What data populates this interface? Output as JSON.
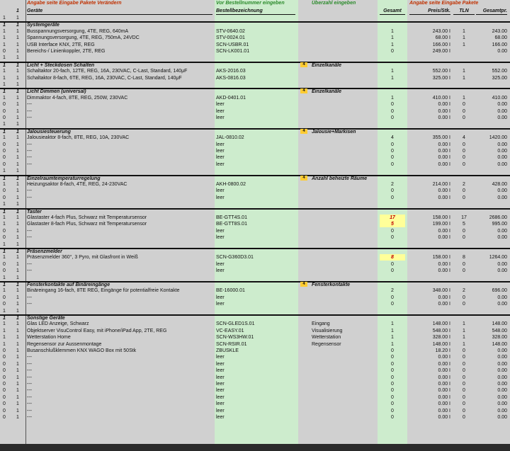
{
  "top_labels": {
    "left": "Angabe seite Eingabe Pakete Verändern",
    "middle": "Vor Bestellnummer eingeben",
    "middle2": "Überzahl eingeben",
    "right": "Angabe seite Eingabe Pakete"
  },
  "header": {
    "col0": "1",
    "geraete": "Geräte",
    "bestellbezeichnung": "Bestellbezeichnung",
    "gesamt": "Gesamt",
    "preis": "Preis/Stk.",
    "tln": "TLN",
    "gesamtpr": "Gesamtpr."
  },
  "rows": [
    {
      "type": "blank",
      "c0": "1",
      "c1": "1"
    },
    {
      "type": "section",
      "c0": "1",
      "c1": "1",
      "title": "Systemgeräte"
    },
    {
      "type": "item",
      "c0": "1",
      "c1": "1",
      "name": "Busspannungsversorgung, 4TE, REG, 640mA",
      "code": "STV-0640.02",
      "qty": "1",
      "price": "243.00 I",
      "tln": "1",
      "total": "243.00"
    },
    {
      "type": "item",
      "c0": "1",
      "c1": "1",
      "name": "Spannungsversorgung, 4TE, REG, 750mA, 24VDC",
      "code": "STV-0024.01",
      "qty": "1",
      "price": "68.00 I",
      "tln": "1",
      "total": "68.00"
    },
    {
      "type": "item",
      "c0": "1",
      "c1": "1",
      "name": "USB Interface KNX, 2TE, REG",
      "code": "SCN-USBR.01",
      "qty": "1",
      "price": "166.00 I",
      "tln": "1",
      "total": "166.00"
    },
    {
      "type": "item",
      "c0": "0",
      "c1": "1",
      "name": "Bereichs-/ Linienkoppler, 2TE, REG",
      "code": "SCN-LK001.01",
      "qty": "0",
      "price": "249.00 I",
      "tln": "",
      "total": "0.00"
    },
    {
      "type": "blank",
      "c0": "1",
      "c1": "1"
    },
    {
      "type": "section",
      "c0": "1",
      "c1": "1",
      "title": "Licht + Steckdosen Schalten",
      "badge": "4",
      "right": "Einzelkanäle"
    },
    {
      "type": "item",
      "c0": "1",
      "c1": "1",
      "name": "Schaltaktor 20-fach, 12TE, REG, 16A, 230VAC, C-Last, Standard, 140μF",
      "code": "AKS-2016.03",
      "qty": "1",
      "price": "552.00 I",
      "tln": "1",
      "total": "552.00"
    },
    {
      "type": "item",
      "c0": "1",
      "c1": "1",
      "name": "Schaltaktor 8-fach, 6TE, REG, 16A, 230VAC, C-Last, Standard, 140μF",
      "code": "AKS-0816.03",
      "qty": "1",
      "price": "325.00 I",
      "tln": "1",
      "total": "325.00"
    },
    {
      "type": "blank",
      "c0": "1",
      "c1": "1"
    },
    {
      "type": "section",
      "c0": "1",
      "c1": "1",
      "title": "Licht Dimmen (universal)",
      "badge": "4",
      "right": "Einzelkanäle"
    },
    {
      "type": "item",
      "c0": "1",
      "c1": "1",
      "name": "Dimmaktor 4-fach, 8TE, REG, 250W, 230VAC",
      "code": "AKD-0401.01",
      "qty": "1",
      "price": "410.00 I",
      "tln": "1",
      "total": "410.00"
    },
    {
      "type": "item",
      "c0": "0",
      "c1": "1",
      "name": "---",
      "code": "leer",
      "qty": "0",
      "price": "0.00 I",
      "tln": "0",
      "total": "0.00"
    },
    {
      "type": "item",
      "c0": "0",
      "c1": "1",
      "name": "---",
      "code": "leer",
      "qty": "0",
      "price": "0.00 I",
      "tln": "0",
      "total": "0.00"
    },
    {
      "type": "item",
      "c0": "0",
      "c1": "1",
      "name": "---",
      "code": "leer",
      "qty": "0",
      "price": "0.00 I",
      "tln": "0",
      "total": "0.00"
    },
    {
      "type": "blank",
      "c0": "1",
      "c1": "1"
    },
    {
      "type": "section",
      "c0": "1",
      "c1": "1",
      "title": "Jalousiesteuerung",
      "badge": "4",
      "right": "Jalousie+Markisen"
    },
    {
      "type": "item",
      "c0": "1",
      "c1": "1",
      "name": "Jalousieaktor 8-fach, 8TE, REG, 10A, 230VAC",
      "code": "JAL-0810.02",
      "qty": "4",
      "price": "355.00 I",
      "tln": "4",
      "total": "1420.00"
    },
    {
      "type": "item",
      "c0": "0",
      "c1": "1",
      "name": "---",
      "code": "leer",
      "qty": "0",
      "price": "0.00 I",
      "tln": "0",
      "total": "0.00"
    },
    {
      "type": "item",
      "c0": "0",
      "c1": "1",
      "name": "---",
      "code": "leer",
      "qty": "0",
      "price": "0.00 I",
      "tln": "0",
      "total": "0.00"
    },
    {
      "type": "item",
      "c0": "0",
      "c1": "1",
      "name": "---",
      "code": "leer",
      "qty": "0",
      "price": "0.00 I",
      "tln": "0",
      "total": "0.00"
    },
    {
      "type": "item",
      "c0": "0",
      "c1": "1",
      "name": "---",
      "code": "leer",
      "qty": "0",
      "price": "0.00 I",
      "tln": "0",
      "total": "0.00"
    },
    {
      "type": "blank",
      "c0": "1",
      "c1": "1"
    },
    {
      "type": "section",
      "c0": "1",
      "c1": "1",
      "title": "Einzelraumtemperaturregelung",
      "badge": "4",
      "right": "Anzahl beheizte Räume"
    },
    {
      "type": "item",
      "c0": "1",
      "c1": "1",
      "name": "Heizungsaktor 8-fach, 4TE, REG, 24-230VAC",
      "code": "AKH-0800.02",
      "qty": "2",
      "price": "214.00 I",
      "tln": "2",
      "total": "428.00"
    },
    {
      "type": "item",
      "c0": "0",
      "c1": "1",
      "name": "---",
      "code": "leer",
      "qty": "0",
      "price": "0.00 I",
      "tln": "0",
      "total": "0.00"
    },
    {
      "type": "item",
      "c0": "0",
      "c1": "1",
      "name": "---",
      "code": "leer",
      "qty": "0",
      "price": "0.00 I",
      "tln": "0",
      "total": "0.00"
    },
    {
      "type": "blank",
      "c0": "1",
      "c1": "1"
    },
    {
      "type": "section",
      "c0": "1",
      "c1": "1",
      "title": "Taster"
    },
    {
      "type": "item",
      "c0": "1",
      "c1": "1",
      "name": "Glastaster 4-fach Plus, Schwarz mit Temperatursensor",
      "code": "BE-GTT4S.01",
      "qty": "17",
      "hl": true,
      "price": "158.00 I",
      "tln": "17",
      "total": "2686.00"
    },
    {
      "type": "item",
      "c0": "1",
      "c1": "1",
      "name": "Glastaster 8-fach Plus, Schwarz mit Temperatursensor",
      "code": "BE-GTT8S.01",
      "qty": "5",
      "hl": true,
      "price": "199.00 I",
      "tln": "5",
      "total": "995.00"
    },
    {
      "type": "item",
      "c0": "0",
      "c1": "1",
      "name": "---",
      "code": "leer",
      "qty": "0",
      "price": "0.00 I",
      "tln": "0",
      "total": "0.00"
    },
    {
      "type": "item",
      "c0": "0",
      "c1": "1",
      "name": "---",
      "code": "leer",
      "qty": "0",
      "price": "0.00 I",
      "tln": "0",
      "total": "0.00"
    },
    {
      "type": "blank",
      "c0": "1",
      "c1": "1"
    },
    {
      "type": "section",
      "c0": "1",
      "c1": "1",
      "title": "Präsenzmelder"
    },
    {
      "type": "item",
      "c0": "1",
      "c1": "1",
      "name": "Präsenzmelder 360°, 3 Pyro, mit Glasfront in Weiß",
      "code": "SCN-G360D3.01",
      "qty": "8",
      "hl": true,
      "price": "158.00 I",
      "tln": "8",
      "total": "1264.00"
    },
    {
      "type": "item",
      "c0": "0",
      "c1": "1",
      "name": "---",
      "code": "leer",
      "qty": "0",
      "price": "0.00 I",
      "tln": "0",
      "total": "0.00"
    },
    {
      "type": "item",
      "c0": "0",
      "c1": "1",
      "name": "---",
      "code": "leer",
      "qty": "0",
      "price": "0.00 I",
      "tln": "0",
      "total": "0.00"
    },
    {
      "type": "blank",
      "c0": "1",
      "c1": "1"
    },
    {
      "type": "section",
      "c0": "1",
      "c1": "1",
      "title": "Fensterkontakte auf Binäreingänge",
      "badge": "4",
      "right": "Fensterkontakte"
    },
    {
      "type": "item",
      "c0": "1",
      "c1": "1",
      "name": "Binäreingang 16-fach, 8TE REG, Eingänge für potentialfreie Kontakte",
      "code": "BE-16000.01",
      "qty": "2",
      "price": "348.00 I",
      "tln": "2",
      "total": "696.00"
    },
    {
      "type": "item",
      "c0": "0",
      "c1": "1",
      "name": "---",
      "code": "leer",
      "qty": "0",
      "price": "0.00 I",
      "tln": "0",
      "total": "0.00"
    },
    {
      "type": "item",
      "c0": "0",
      "c1": "1",
      "name": "---",
      "code": "leer",
      "qty": "0",
      "price": "0.00 I",
      "tln": "0",
      "total": "0.00"
    },
    {
      "type": "blank",
      "c0": "1",
      "c1": "1"
    },
    {
      "type": "section",
      "c0": "1",
      "c1": "1",
      "title": "Sonstige Geräte"
    },
    {
      "type": "item",
      "c0": "1",
      "c1": "1",
      "name": "Glas LED Anzeige, Schwarz",
      "code": "SCN-GLED1S.01",
      "note": "Eingang",
      "qty": "1",
      "price": "148.00 I",
      "tln": "1",
      "total": "148.00"
    },
    {
      "type": "item",
      "c0": "1",
      "c1": "1",
      "name": "Objektserver VisuControl Easy, mit iPhone/iPad App, 2TE, REG",
      "code": "VC-EASY.01",
      "note": "Visualisierung",
      "qty": "1",
      "price": "548.00 I",
      "tln": "1",
      "total": "548.00"
    },
    {
      "type": "item",
      "c0": "1",
      "c1": "1",
      "name": "Wetterstation Home",
      "code": "SCN-WS3HW.01",
      "note": "Wetterstation",
      "qty": "1",
      "price": "328.00 I",
      "tln": "1",
      "total": "328.00"
    },
    {
      "type": "item",
      "c0": "1",
      "c1": "1",
      "name": "Regensensor zur Aussenmontage",
      "code": "SCN-RSIR.01",
      "note": "Regensensor",
      "qty": "1",
      "price": "148.00 I",
      "tln": "1",
      "total": "148.00"
    },
    {
      "type": "item",
      "c0": "0",
      "c1": "1",
      "name": "Busanschlußklemmen KNX WAGO Box mit 50Stk",
      "code": "ZBUSKLE",
      "qty": "0",
      "price": "18.20 I",
      "tln": "0",
      "total": "0.00"
    },
    {
      "type": "item",
      "c0": "0",
      "c1": "1",
      "name": "---",
      "code": "leer",
      "qty": "0",
      "price": "0.00 I",
      "tln": "0",
      "total": "0.00"
    },
    {
      "type": "item",
      "c0": "0",
      "c1": "1",
      "name": "---",
      "code": "leer",
      "qty": "0",
      "price": "0.00 I",
      "tln": "0",
      "total": "0.00"
    },
    {
      "type": "item",
      "c0": "0",
      "c1": "1",
      "name": "---",
      "code": "leer",
      "qty": "0",
      "price": "0.00 I",
      "tln": "0",
      "total": "0.00"
    },
    {
      "type": "item",
      "c0": "0",
      "c1": "1",
      "name": "---",
      "code": "leer",
      "qty": "0",
      "price": "0.00 I",
      "tln": "0",
      "total": "0.00"
    },
    {
      "type": "item",
      "c0": "0",
      "c1": "1",
      "name": "---",
      "code": "leer",
      "qty": "0",
      "price": "0.00 I",
      "tln": "0",
      "total": "0.00"
    },
    {
      "type": "item",
      "c0": "0",
      "c1": "1",
      "name": "---",
      "code": "leer",
      "qty": "0",
      "price": "0.00 I",
      "tln": "0",
      "total": "0.00"
    },
    {
      "type": "item",
      "c0": "0",
      "c1": "1",
      "name": "---",
      "code": "leer",
      "qty": "0",
      "price": "0.00 I",
      "tln": "0",
      "total": "0.00"
    },
    {
      "type": "item",
      "c0": "0",
      "c1": "1",
      "name": "---",
      "code": "leer",
      "qty": "0",
      "price": "0.00 I",
      "tln": "0",
      "total": "0.00"
    },
    {
      "type": "item",
      "c0": "0",
      "c1": "1",
      "name": "---",
      "code": "leer",
      "qty": "0",
      "price": "0.00 I",
      "tln": "0",
      "total": "0.00"
    },
    {
      "type": "item",
      "c0": "0",
      "c1": "1",
      "name": "---",
      "code": "leer",
      "qty": "0",
      "price": "0.00 I",
      "tln": "0",
      "total": "0.00"
    }
  ]
}
